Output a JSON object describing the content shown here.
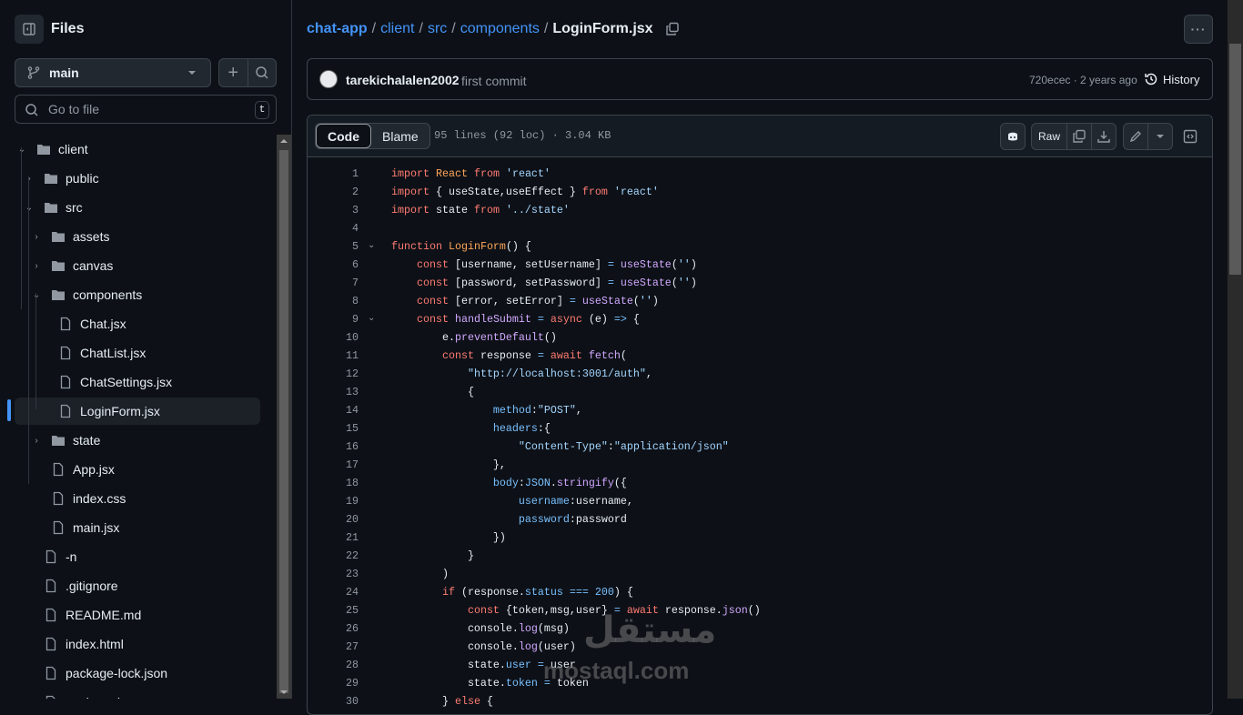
{
  "sidebar": {
    "title": "Files",
    "branch": "main",
    "search_placeholder": "Go to file",
    "search_shortcut": "t",
    "tree": [
      {
        "label": "client",
        "type": "folder",
        "depth": 0,
        "open": true
      },
      {
        "label": "public",
        "type": "folder",
        "depth": 1,
        "open": false
      },
      {
        "label": "src",
        "type": "folder",
        "depth": 1,
        "open": true
      },
      {
        "label": "assets",
        "type": "folder",
        "depth": 2,
        "open": false
      },
      {
        "label": "canvas",
        "type": "folder",
        "depth": 2,
        "open": false
      },
      {
        "label": "components",
        "type": "folder",
        "depth": 2,
        "open": true
      },
      {
        "label": "Chat.jsx",
        "type": "file",
        "depth": 3
      },
      {
        "label": "ChatList.jsx",
        "type": "file",
        "depth": 3
      },
      {
        "label": "ChatSettings.jsx",
        "type": "file",
        "depth": 3
      },
      {
        "label": "LoginForm.jsx",
        "type": "file",
        "depth": 3,
        "selected": true
      },
      {
        "label": "state",
        "type": "folder",
        "depth": 2,
        "open": false
      },
      {
        "label": "App.jsx",
        "type": "file",
        "depth": 2
      },
      {
        "label": "index.css",
        "type": "file",
        "depth": 2
      },
      {
        "label": "main.jsx",
        "type": "file",
        "depth": 2
      },
      {
        "label": "-n",
        "type": "file",
        "depth": 1
      },
      {
        "label": ".gitignore",
        "type": "file",
        "depth": 1
      },
      {
        "label": "README.md",
        "type": "file",
        "depth": 1
      },
      {
        "label": "index.html",
        "type": "file",
        "depth": 1
      },
      {
        "label": "package-lock.json",
        "type": "file",
        "depth": 1
      },
      {
        "label": "package.json",
        "type": "file",
        "depth": 1
      }
    ]
  },
  "breadcrumb": {
    "parts": [
      "chat-app",
      "client",
      "src",
      "components"
    ],
    "current": "LoginForm.jsx"
  },
  "commit": {
    "author": "tarekichalalen2002",
    "message": "first commit",
    "sha_time": "720ecec · 2 years ago",
    "history": "History"
  },
  "file": {
    "tabs": [
      "Code",
      "Blame"
    ],
    "info": "95 lines (92 loc) · 3.04 KB",
    "raw": "Raw"
  },
  "code": [
    {
      "n": "1",
      "raw": "import React from 'react'"
    },
    {
      "n": "2",
      "raw": "import { useState,useEffect } from 'react'"
    },
    {
      "n": "3",
      "raw": "import state from '../state'"
    },
    {
      "n": "4",
      "raw": ""
    },
    {
      "n": "5",
      "fold": true,
      "raw": "function LoginForm() {"
    },
    {
      "n": "6",
      "raw": "    const [username, setUsername] = useState('')"
    },
    {
      "n": "7",
      "raw": "    const [password, setPassword] = useState('')"
    },
    {
      "n": "8",
      "raw": "    const [error, setError] = useState('')"
    },
    {
      "n": "9",
      "fold": true,
      "raw": "    const handleSubmit = async (e) => {"
    },
    {
      "n": "10",
      "raw": "        e.preventDefault()"
    },
    {
      "n": "11",
      "raw": "        const response = await fetch("
    },
    {
      "n": "12",
      "raw": "            \"http://localhost:3001/auth\","
    },
    {
      "n": "13",
      "raw": "            {"
    },
    {
      "n": "14",
      "raw": "                method:\"POST\","
    },
    {
      "n": "15",
      "raw": "                headers:{"
    },
    {
      "n": "16",
      "raw": "                    \"Content-Type\":\"application/json\""
    },
    {
      "n": "17",
      "raw": "                },"
    },
    {
      "n": "18",
      "raw": "                body:JSON.stringify({"
    },
    {
      "n": "19",
      "raw": "                    username:username,"
    },
    {
      "n": "20",
      "raw": "                    password:password"
    },
    {
      "n": "21",
      "raw": "                })"
    },
    {
      "n": "22",
      "raw": "            }"
    },
    {
      "n": "23",
      "raw": "        )"
    },
    {
      "n": "24",
      "raw": "        if (response.status === 200) {"
    },
    {
      "n": "25",
      "raw": "            const {token,msg,user} = await response.json()"
    },
    {
      "n": "26",
      "raw": "            console.log(msg)"
    },
    {
      "n": "27",
      "raw": "            console.log(user)"
    },
    {
      "n": "28",
      "raw": "            state.user = user"
    },
    {
      "n": "29",
      "raw": "            state.token = token"
    },
    {
      "n": "30",
      "raw": "        } else {"
    }
  ],
  "watermark": {
    "arabic": "مستقل",
    "latin": "mostaql.com"
  }
}
